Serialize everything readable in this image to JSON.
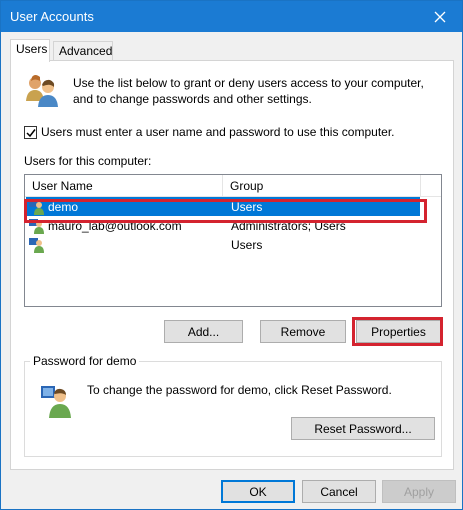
{
  "window": {
    "title": "User Accounts"
  },
  "tabs": [
    {
      "label": "Users",
      "active": true
    },
    {
      "label": "Advanced",
      "active": false
    }
  ],
  "intro": {
    "line1": "Use the list below to grant or deny users access to your computer,",
    "line2": "and to change passwords and other settings."
  },
  "require_password": {
    "label": "Users must enter a user name and password to use this computer.",
    "checked": true
  },
  "users_section": {
    "label": "Users for this computer:",
    "columns": [
      "User Name",
      "Group"
    ],
    "rows": [
      {
        "name": "demo",
        "group": "Users",
        "selected": true
      },
      {
        "name": "mauro_lab@outlook.com",
        "group": "Administrators; Users",
        "selected": false
      },
      {
        "name": "",
        "group": "Users",
        "selected": false
      }
    ]
  },
  "list_buttons": {
    "add": "Add...",
    "remove": "Remove",
    "properties": "Properties"
  },
  "password_group": {
    "title": "Password for demo",
    "text": "To change the password for demo, click Reset Password.",
    "reset_button": "Reset Password..."
  },
  "dialog_buttons": {
    "ok": "OK",
    "cancel": "Cancel",
    "apply": "Apply"
  },
  "colors": {
    "titlebar": "#1b7bd3",
    "selection": "#0078d7",
    "annotation": "#d4232f"
  },
  "icons": {
    "intro": "users-group-icon",
    "row": "user-icon",
    "password": "user-key-icon",
    "close": "close-icon"
  }
}
